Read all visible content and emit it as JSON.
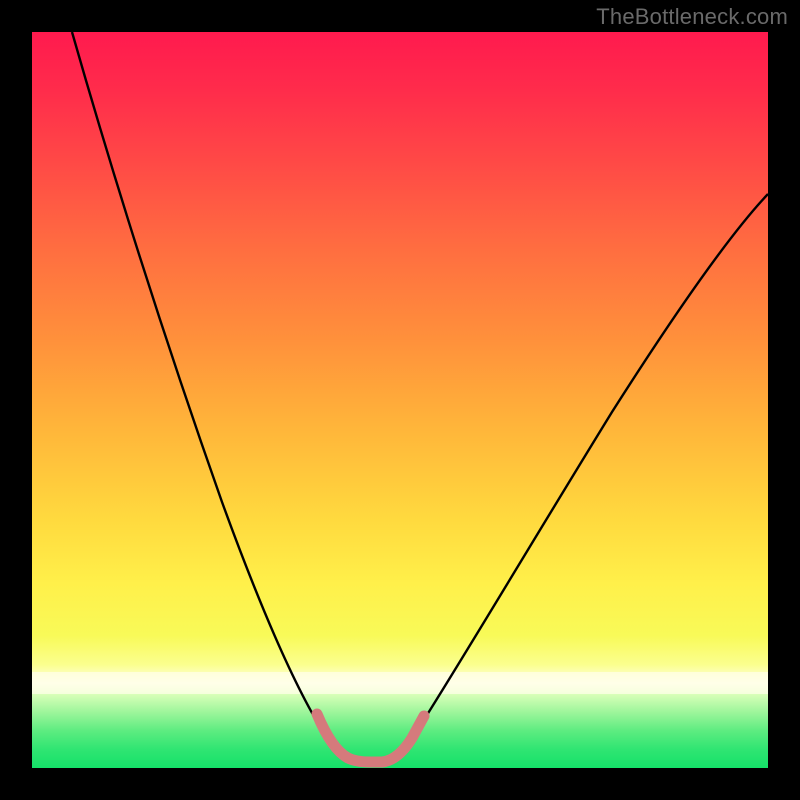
{
  "watermark": {
    "text": "TheBottleneck.com"
  },
  "colors": {
    "black": "#000000",
    "curve": "#000000",
    "highlight": "#d57a7c",
    "green": "#17e36b",
    "yellow": "#fff253",
    "orange": "#ffa03a",
    "red": "#ff1f4c",
    "lightgreen": "#a1f59c"
  },
  "chart_data": {
    "type": "line",
    "title": "",
    "xlabel": "",
    "ylabel": "",
    "xlim": [
      0,
      100
    ],
    "ylim": [
      0,
      100
    ],
    "grid": false,
    "legend": false,
    "series": [
      {
        "name": "bottleneck-curve",
        "x": [
          0,
          4,
          8,
          12,
          16,
          20,
          24,
          28,
          32,
          35,
          38,
          40,
          42,
          44,
          47,
          50,
          55,
          60,
          65,
          70,
          75,
          80,
          85,
          90,
          95,
          100
        ],
        "y": [
          100,
          90,
          80,
          70,
          60,
          50,
          41,
          32,
          23,
          15,
          8,
          4,
          2,
          2,
          4,
          8,
          15,
          23,
          31,
          39,
          46,
          53,
          60,
          66,
          72,
          78
        ]
      }
    ],
    "highlight": {
      "from_x": 38,
      "to_x": 48,
      "y_max": 8
    },
    "annotations": []
  }
}
